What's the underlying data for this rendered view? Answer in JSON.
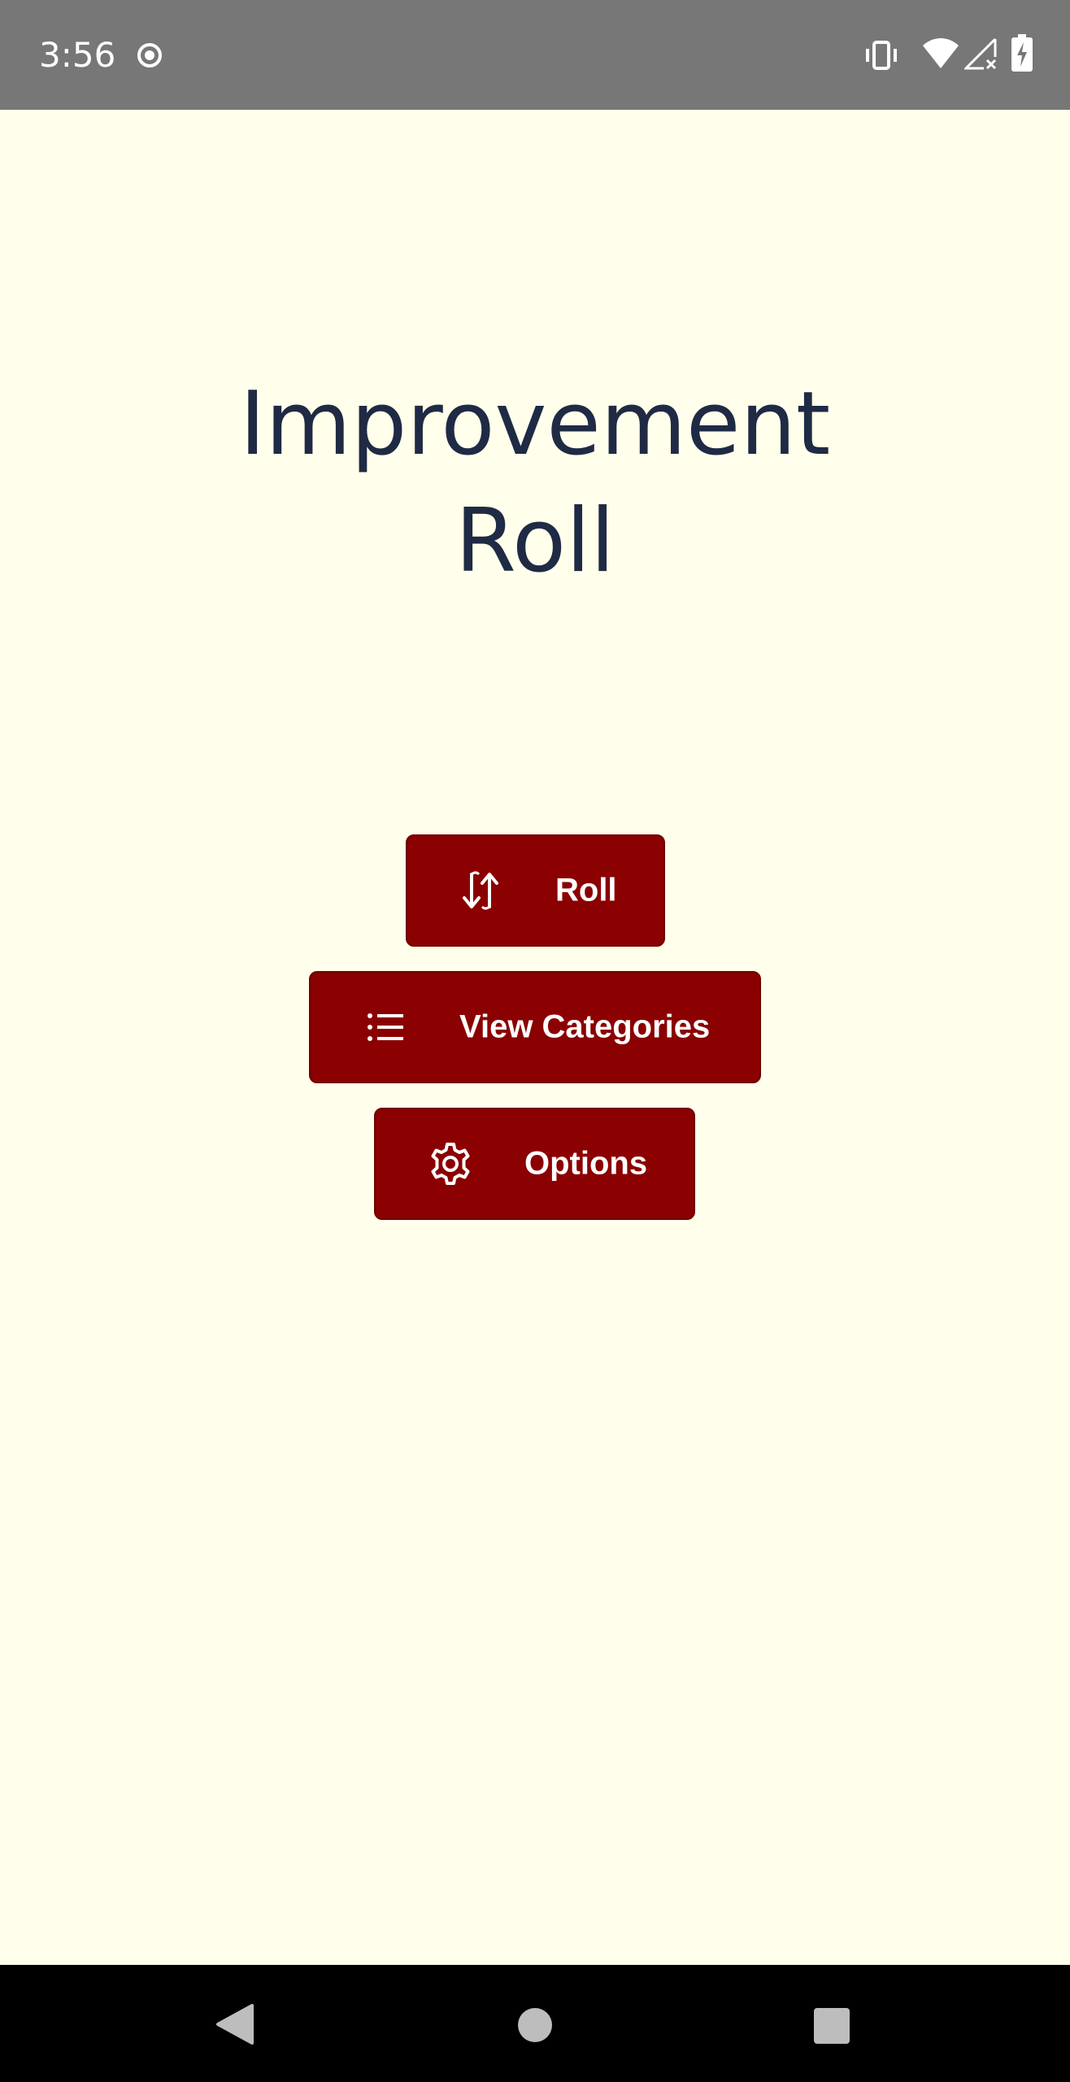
{
  "status_bar": {
    "time": "3:56",
    "icons": [
      "record-icon",
      "vibrate-icon",
      "wifi-icon",
      "signal-no-service-icon",
      "battery-charging-icon"
    ]
  },
  "app": {
    "title": "Improvement\nRoll"
  },
  "buttons": {
    "roll": {
      "label": "Roll",
      "icon": "swap-vertical-icon"
    },
    "categories": {
      "label": "View Categories",
      "icon": "list-icon"
    },
    "options": {
      "label": "Options",
      "icon": "gear-icon"
    }
  },
  "nav_bar": {
    "icons": [
      "back-icon",
      "home-icon",
      "recents-icon"
    ]
  },
  "colors": {
    "background": "#FFFFEB",
    "button": "#8B0000",
    "title": "#1F2A44",
    "status_bar": "#777777"
  }
}
